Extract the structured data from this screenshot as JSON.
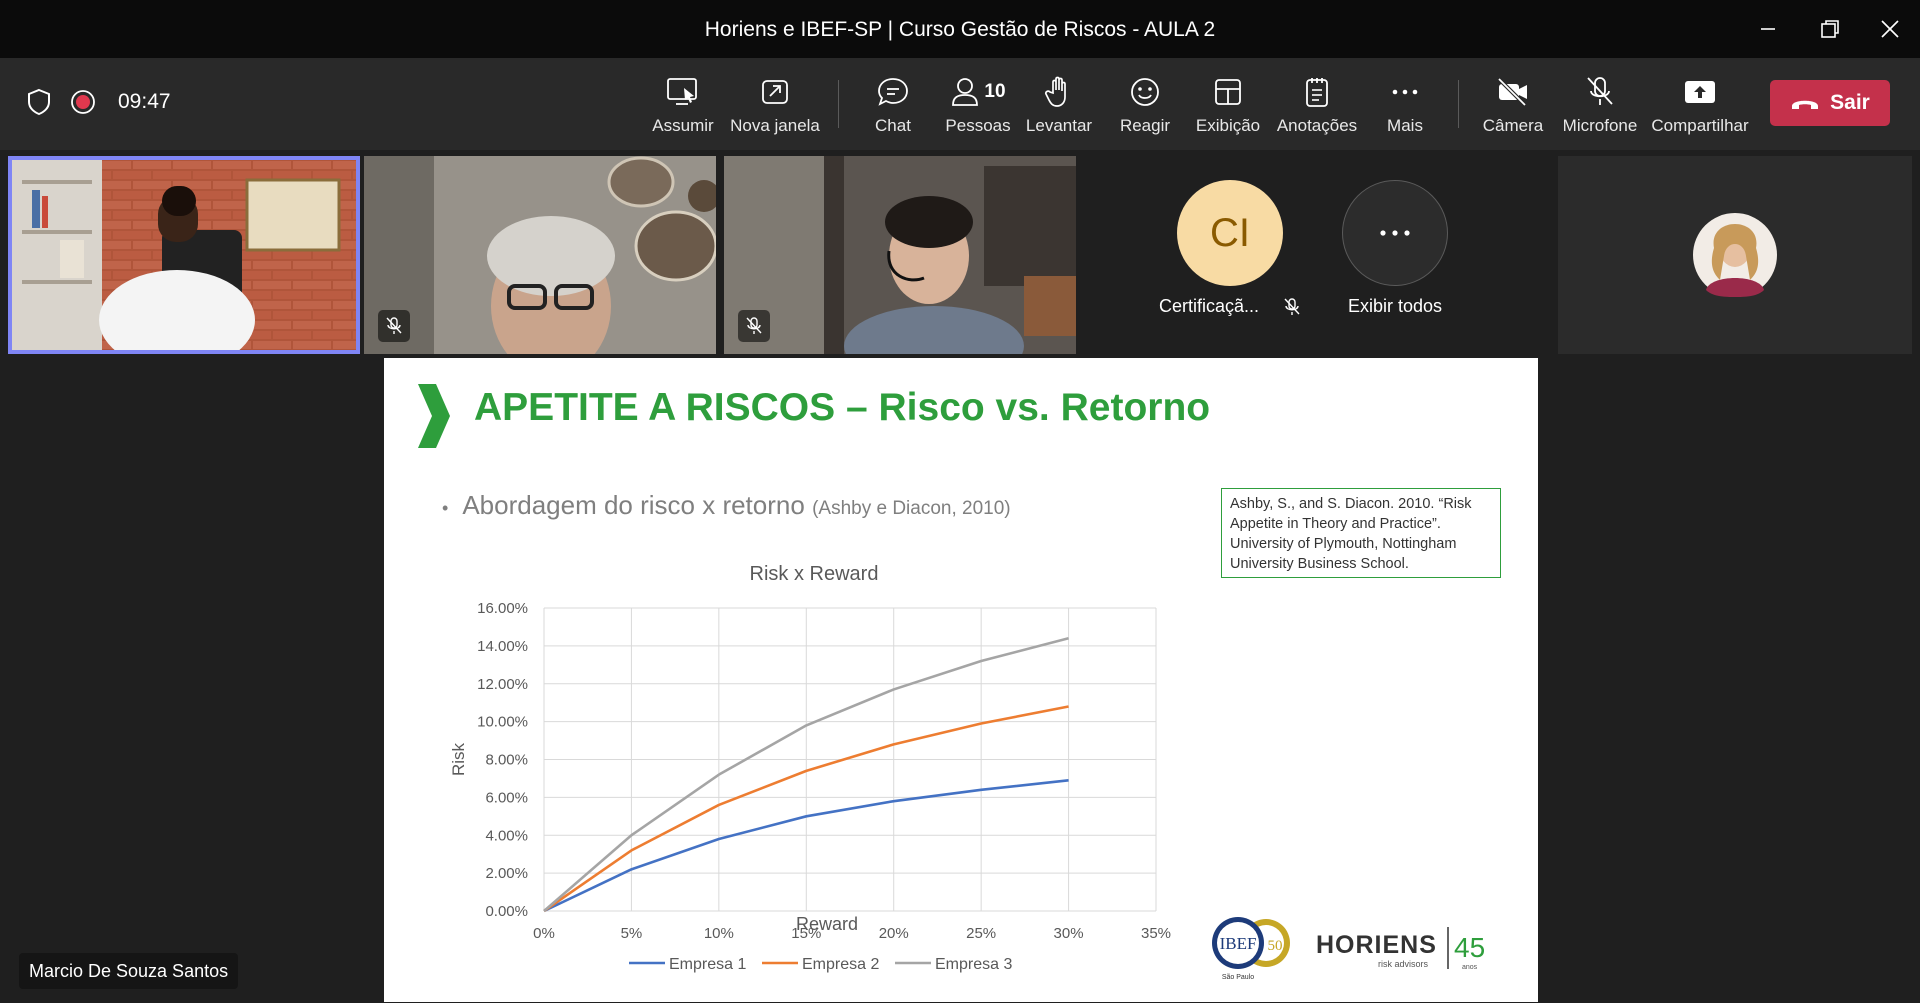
{
  "window": {
    "title": "Horiens e IBEF-SP | Curso Gestão de Riscos - AULA 2"
  },
  "toolbar": {
    "time": "09:47",
    "buttons": [
      {
        "label": "Assumir",
        "icon": "take-control-icon"
      },
      {
        "label": "Nova janela",
        "icon": "pop-out-icon"
      },
      {
        "label": "Chat",
        "icon": "chat-icon"
      },
      {
        "label": "Pessoas",
        "icon": "people-icon",
        "count": "10"
      },
      {
        "label": "Levantar",
        "icon": "raise-hand-icon"
      },
      {
        "label": "Reagir",
        "icon": "smiley-icon"
      },
      {
        "label": "Exibição",
        "icon": "layout-icon"
      },
      {
        "label": "Anotações",
        "icon": "notes-icon"
      },
      {
        "label": "Mais",
        "icon": "more-icon"
      },
      {
        "label": "Câmera",
        "icon": "camera-off-icon"
      },
      {
        "label": "Microfone",
        "icon": "mic-off-icon"
      },
      {
        "label": "Compartilhar",
        "icon": "share-icon"
      }
    ],
    "leave_label": "Sair",
    "colors": {
      "leave": "#c4314b",
      "record": "#e0384e"
    }
  },
  "participants": {
    "initials": "CI",
    "initials_name": "Certificaçã...",
    "show_all_label": "Exibir todos",
    "active_speaker": "Marcio De Souza Santos",
    "colors": {
      "highlight": "#7f85f5",
      "initials_bg": "#f8dba4",
      "initials_fg": "#8a5a00"
    }
  },
  "slide": {
    "title": "APETITE A RISCOS – Risco vs. Retorno",
    "bullet_main": "Abordagem do risco x retorno",
    "bullet_ref": "(Ashby e Diacon, 2010)",
    "reference": "Ashby, S., and S. Diacon. 2010. “Risk Appetite in Theory and Practice”. University of Plymouth, Nottingham University Business School.",
    "logo_ibef_text": "IBEF",
    "logo_ibef_number": "50",
    "logo_ibef_sub": "São Paulo",
    "logo_horiens_text": "HORIENS",
    "logo_horiens_sub": "risk advisors",
    "logo_horiens_years": "45",
    "logo_horiens_years_sub": "anos",
    "accent": "#2e9e3c"
  },
  "chart_data": {
    "type": "line",
    "title": "Risk x Reward",
    "xlabel": "Reward",
    "ylabel": "Risk",
    "x": [
      0,
      0.05,
      0.1,
      0.15,
      0.2,
      0.25,
      0.3
    ],
    "xlim": [
      0,
      0.35
    ],
    "ylim": [
      0,
      0.16
    ],
    "x_ticks": [
      "0%",
      "5%",
      "10%",
      "15%",
      "20%",
      "25%",
      "30%",
      "35%"
    ],
    "y_ticks": [
      "0.00%",
      "2.00%",
      "4.00%",
      "6.00%",
      "8.00%",
      "10.00%",
      "12.00%",
      "14.00%",
      "16.00%"
    ],
    "grid": true,
    "legend": "bottom",
    "series": [
      {
        "name": "Empresa 1",
        "color": "#4472c4",
        "values": [
          0,
          0.022,
          0.038,
          0.05,
          0.058,
          0.064,
          0.069
        ]
      },
      {
        "name": "Empresa 2",
        "color": "#ed7d31",
        "values": [
          0,
          0.032,
          0.056,
          0.074,
          0.088,
          0.099,
          0.108
        ]
      },
      {
        "name": "Empresa 3",
        "color": "#a5a5a5",
        "values": [
          0,
          0.04,
          0.072,
          0.098,
          0.117,
          0.132,
          0.144
        ]
      }
    ]
  }
}
